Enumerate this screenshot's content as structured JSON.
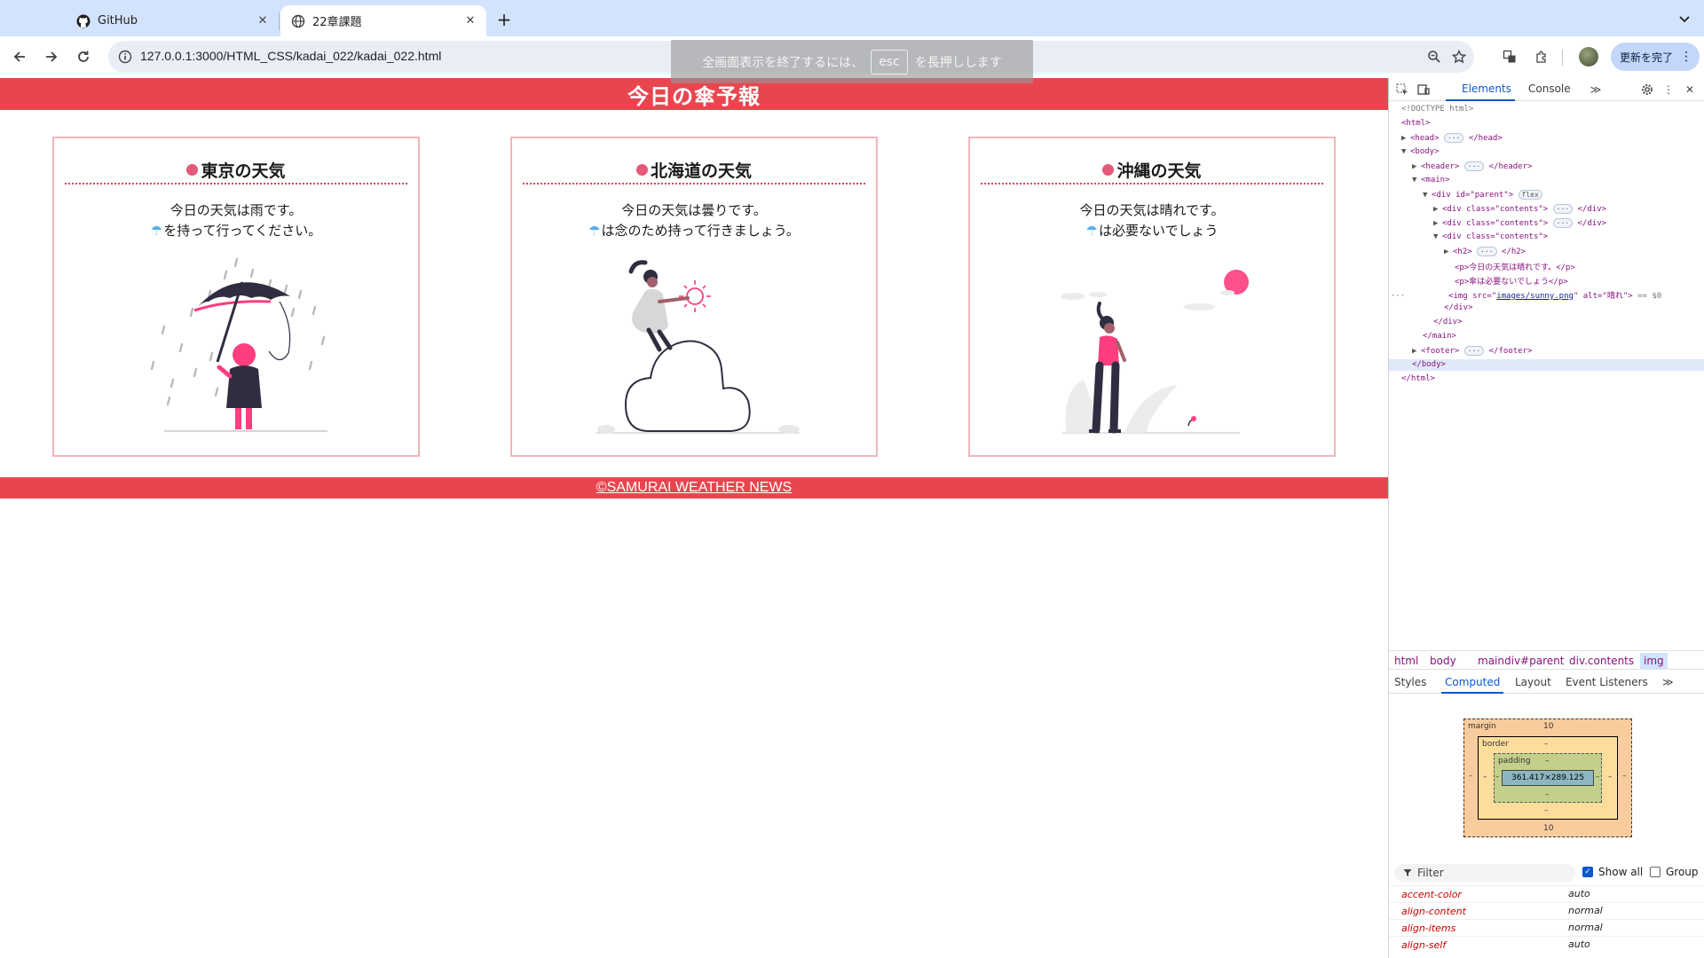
{
  "browser": {
    "tabs": [
      {
        "title": "GitHub",
        "icon": "github-icon",
        "active": false
      },
      {
        "title": "22章課題",
        "icon": "globe-icon",
        "active": true
      }
    ],
    "url": "127.0.0.1:3000/HTML_CSS/kadai_022/kadai_022.html",
    "update_button_label": "更新を完了",
    "fullscreen_toast": {
      "before": "全画面表示を終了するには、",
      "key": "esc",
      "after": "を長押しします"
    }
  },
  "page": {
    "header_title": "今日の傘予報",
    "accent_color": "#e8464f",
    "cards": [
      {
        "title": "東京の天気",
        "line1": "今日の天気は雨です。",
        "umbrella_glyph": "☂",
        "line2": "を持って行ってください。",
        "illustration": "rainy-umbrella-illustration"
      },
      {
        "title": "北海道の天気",
        "line1": "今日の天気は曇りです。",
        "umbrella_glyph": "☂",
        "line2": "は念のため持って行きましょう。",
        "illustration": "cloudy-sitting-illustration"
      },
      {
        "title": "沖縄の天気",
        "line1": "今日の天気は晴れです。",
        "umbrella_glyph": "☂",
        "line2": "は必要ないでしょう",
        "illustration": "sunny-walking-illustration"
      }
    ],
    "footer_text": "©SAMURAI WEATHER NEWS"
  },
  "devtools": {
    "tabs": [
      "Elements",
      "Console"
    ],
    "active_tab": "Elements",
    "dom": {
      "doctype": "<!DOCTYPE html>",
      "html_open": "<html>",
      "head": "<head>",
      "head_close": "</head>",
      "body_open": "<body>",
      "header": "<header>",
      "header_close": "</header>",
      "main_open": "<main>",
      "div_parent": "<div id=\"parent\">",
      "flex_badge": "flex",
      "div_contents": "<div class=\"contents\">",
      "div_close": "</div>",
      "h2": "<h2>",
      "h2_close": "</h2>",
      "p1": "<p>今日の天気は晴れです。</p>",
      "p2": "<p>傘は必要ないでしょう</p>",
      "img_prefix": "<img src=\"",
      "img_src": "images/sunny.png",
      "img_alt": "\" alt=\"晴れ\">",
      "img_ref": "== $0",
      "main_close": "</main>",
      "footer": "<footer>",
      "footer_close": "</footer>",
      "body_close": "</body>",
      "html_close": "</html>",
      "ellipsis": "···"
    },
    "breadcrumbs": [
      "html",
      "body",
      "main",
      "div#parent",
      "div.contents",
      "img"
    ],
    "subtabs": [
      "Styles",
      "Computed",
      "Layout",
      "Event Listeners"
    ],
    "active_subtab": "Computed",
    "box_model": {
      "margin_label": "margin",
      "margin_top": "10",
      "margin_bottom": "10",
      "border_label": "border",
      "padding_label": "padding",
      "dash": "–",
      "content_size": "361.417×289.125"
    },
    "filter_placeholder": "Filter",
    "show_all_label": "Show all",
    "show_all_checked": true,
    "group_label": "Group",
    "group_checked": false,
    "properties": [
      {
        "name": "accent-color",
        "value": "auto"
      },
      {
        "name": "align-content",
        "value": "normal"
      },
      {
        "name": "align-items",
        "value": "normal"
      },
      {
        "name": "align-self",
        "value": "auto"
      }
    ]
  }
}
